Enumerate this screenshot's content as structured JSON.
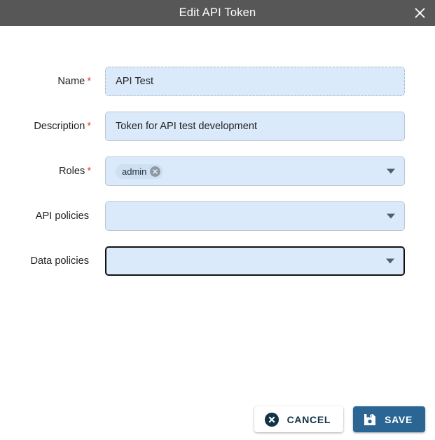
{
  "dialog": {
    "title": "Edit API Token",
    "close_icon": "close-icon",
    "header_color": "#575757"
  },
  "form": {
    "fields": [
      {
        "label": "Name",
        "required": true,
        "required_marker": "*",
        "value": "API Test",
        "placeholder": "",
        "type": "text",
        "state": "dashed"
      },
      {
        "label": "Description",
        "required": true,
        "required_marker": "*",
        "value": "Token for API test development",
        "placeholder": "",
        "type": "text",
        "state": "solid"
      },
      {
        "label": "Roles",
        "required": true,
        "required_marker": "*",
        "value": "",
        "placeholder": "",
        "type": "multiselect",
        "state": "solid",
        "chips": [
          {
            "label": "admin",
            "remove_icon": "close-circle-icon"
          }
        ],
        "caret_icon": "chevron-down-icon"
      },
      {
        "label": "API policies",
        "required": false,
        "required_marker": "",
        "value": "",
        "placeholder": "",
        "type": "multiselect",
        "state": "solid",
        "chips": [],
        "caret_icon": "chevron-down-icon"
      },
      {
        "label": "Data policies",
        "required": false,
        "required_marker": "",
        "value": "",
        "placeholder": "",
        "type": "multiselect",
        "state": "focused",
        "chips": [],
        "caret_icon": "chevron-down-icon"
      }
    ]
  },
  "footer": {
    "cancel_label": "CANCEL",
    "cancel_icon": "close-circle-icon",
    "save_label": "SAVE",
    "save_icon": "save-floppy-disk-icon"
  },
  "colors": {
    "header_bg": "#575757",
    "field_bg": "#dbeafa",
    "field_border": "#b9c6d4",
    "focus_border": "#111111",
    "required_asterisk": "#e53935",
    "chip_bg": "#cfe0f2",
    "chip_remove_bg": "#8d9aa6",
    "save_bg": "#2b6593",
    "cancel_fg": "#123247",
    "caret": "#52606d"
  }
}
